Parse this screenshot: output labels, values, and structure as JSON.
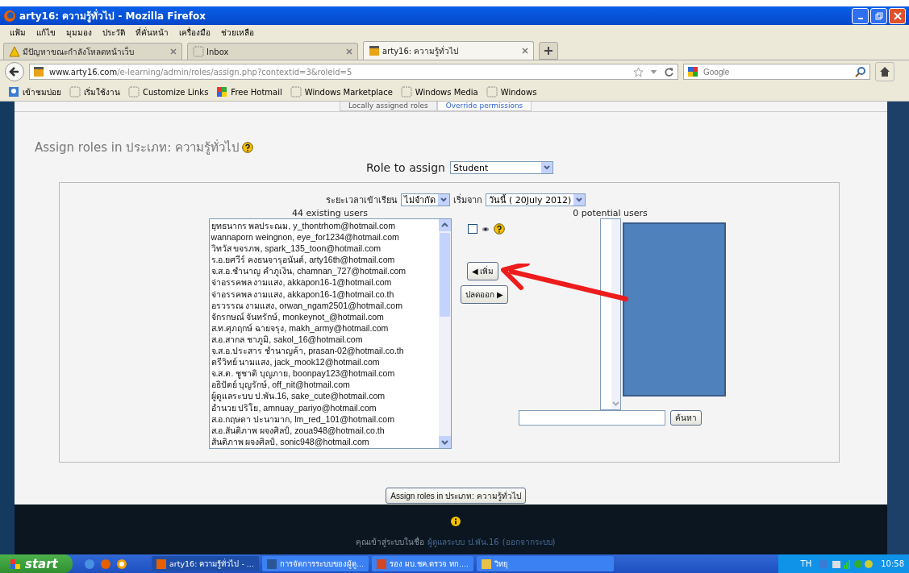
{
  "window": {
    "title": "arty16: ความรู้ทั่วไป - Mozilla Firefox"
  },
  "menu": [
    "แฟ้ม",
    "แก้ไข",
    "มุมมอง",
    "ประวัติ",
    "ที่คั่นหน้า",
    "เครื่องมือ",
    "ช่วยเหลือ"
  ],
  "browser_tabs": [
    {
      "label": "มีปัญหาขณะกำลังโหลดหน้าเว็บ",
      "kind": "warning",
      "selected": false
    },
    {
      "label": "Inbox",
      "kind": "blank",
      "selected": false
    },
    {
      "label": "arty16: ความรู้ทั่วไป",
      "kind": "site",
      "selected": true
    }
  ],
  "address_bar": {
    "host": "www.arty16.com",
    "path": "/e-learning/admin/roles/assign.php?contextid=3&roleid=5"
  },
  "search_bar": {
    "placeholder": "Google"
  },
  "bookmarks": [
    {
      "label": "เข้าชมบ่อย",
      "kind": "folder"
    },
    {
      "label": "เริ่มใช้งาน",
      "kind": "page"
    },
    {
      "label": "Customize Links",
      "kind": "page"
    },
    {
      "label": "Free Hotmail",
      "kind": "windows"
    },
    {
      "label": "Windows Marketplace",
      "kind": "page"
    },
    {
      "label": "Windows Media",
      "kind": "page"
    },
    {
      "label": "Windows",
      "kind": "page"
    }
  ],
  "page_tabs": [
    {
      "label": "Locally assigned roles",
      "selected": true
    },
    {
      "label": "Override permissions",
      "selected": false
    }
  ],
  "heading": "Assign roles in ประเภท: ความรู้ทั่วไป",
  "role_to_assign": {
    "label": "Role to assign",
    "value": "Student"
  },
  "enrolment": {
    "duration_label": "ระยะเวลาเข้าเรียน",
    "duration_value": "ไม่จำกัด",
    "start_label": "เริ่มจาก",
    "start_value": "วันนี้ ( 20July 2012)"
  },
  "existing_users": {
    "header": "44 existing users",
    "items": [
      "ยุทธนากร พลประณม, y_thontrhom@hotmail.com",
      "wannaporn weingnon, eye_for1234@hotmail.com",
      "วิทวัส ขจรภพ, spark_135_toon@hotmail.com",
      "ร.อ.ยศวีร์ คงธนจารุอนันต์, arty16th@hotmail.com",
      "จ.ส.อ.ชำนาญ คำภูเงิน, chamnan_727@hotmail.com",
      "จ่าอรรคพล งามแสง, akkapon16-1@hotmail.com",
      "จ่าอรรคพล งามแสง, akkapon16-1@hotmail.co.th",
      "อรวรรณ งามแสง, orwan_ngam2501@hotmail.com",
      "จักรกษณ์ จันทรักษ์, monkeynot_@hotmail.com",
      "ส.ท.ศุภฤกษ์ ฉายจรุง, makh_army@hotmail.com",
      "ส.อ.สากล ชาภูมิ, sakol_16@hotmail.com",
      "จ.ส.อ.ประสาร ชำนาญค้า, prasan-02@hotmail.co.th",
      "ตรีวิทย์ นามแสง, jack_mook12@hotmail.com",
      "จ.ส.ต. ชูชาติ บุญภาย, boonpay123@hotmail.com",
      "อธิปัตย์ บุญรักษ์, off_nit@hotmail.com",
      "ผู้ดูแลระบบ ป.พัน.16, sake_cute@hotmail.com",
      "อำนวย ปริโย, amnuay_pariyo@hotmail.com",
      "ส.อ.กฤษดา ปะนามาก, lm_red_101@hotmail.com",
      "ส.อ.สันติภาพ ผจงศิลป์, zoua948@hotmail.co.th",
      "สันติภาพ ผจงศิลป์, sonic948@hotmail.com"
    ]
  },
  "hidden_checkbox": {
    "checked": false
  },
  "add_button": "◀ เพิ่ม",
  "remove_button": "ปลดออก ▶",
  "potential_users": {
    "header": "0 potential users",
    "search_button": "ค้นหา"
  },
  "submit_button": "Assign roles in ประเภท: ความรู้ทั่วไป",
  "footer": {
    "text": "คุณเข้าสู่ระบบในชื่อ",
    "user_link": "ผู้ดูแลระบบ ป.พัน.16",
    "logout_link": "(ออกจากระบบ)"
  },
  "taskbar": {
    "start": "start",
    "windows": [
      {
        "label": "arty16: ความรู้ทั่วไป - ...",
        "kind": "firefox",
        "selected": true
      },
      {
        "label": "การจัดการระบบของผู้ดู...",
        "kind": "word",
        "selected": false
      },
      {
        "label": "รอง ผบ.ชค.ตรวจ ทก....",
        "kind": "powerpoint",
        "selected": false
      },
      {
        "label": "วิทยุ",
        "kind": "folder",
        "selected": false
      }
    ],
    "language": "TH",
    "clock": "10:58"
  }
}
